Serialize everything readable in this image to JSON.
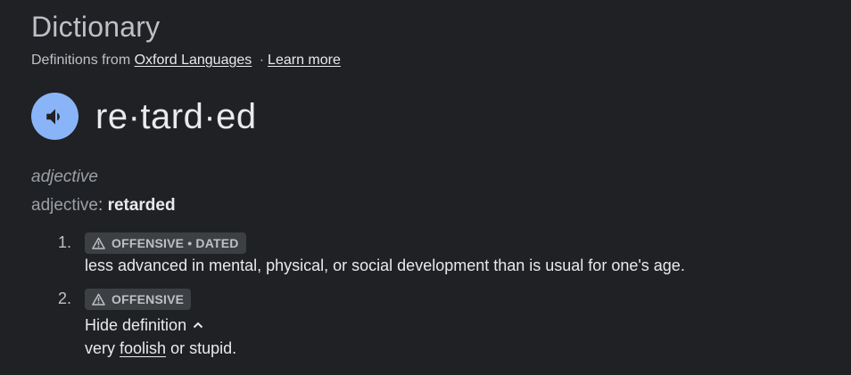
{
  "header": {
    "title": "Dictionary",
    "source_prefix": "Definitions from",
    "source_link": "Oxford Languages",
    "separator": "·",
    "learn_more": "Learn more"
  },
  "entry": {
    "audio_icon": "speaker-icon",
    "headword": "re·tard·ed",
    "part_of_speech": "adjective",
    "inflection_label": "adjective",
    "inflection_colon": ":",
    "inflection_word": "retarded"
  },
  "senses": [
    {
      "number": "1.",
      "label": "OFFENSIVE • DATED",
      "label_icon": "warning-icon",
      "definition": "less advanced in mental, physical, or social development than is usual for one's age."
    },
    {
      "number": "2.",
      "label": "OFFENSIVE",
      "label_icon": "warning-icon",
      "toggle_label": "Hide definition",
      "toggle_icon": "chevron-up-icon",
      "definition_pre": "very",
      "definition_link": "foolish",
      "definition_post": "or stupid."
    }
  ],
  "colors": {
    "background": "#202124",
    "text_primary": "#e8eaed",
    "text_secondary": "#bdc1c6",
    "text_muted": "#9aa0a6",
    "audio_button": "#8ab4f8",
    "chip_background": "#3c4043"
  }
}
